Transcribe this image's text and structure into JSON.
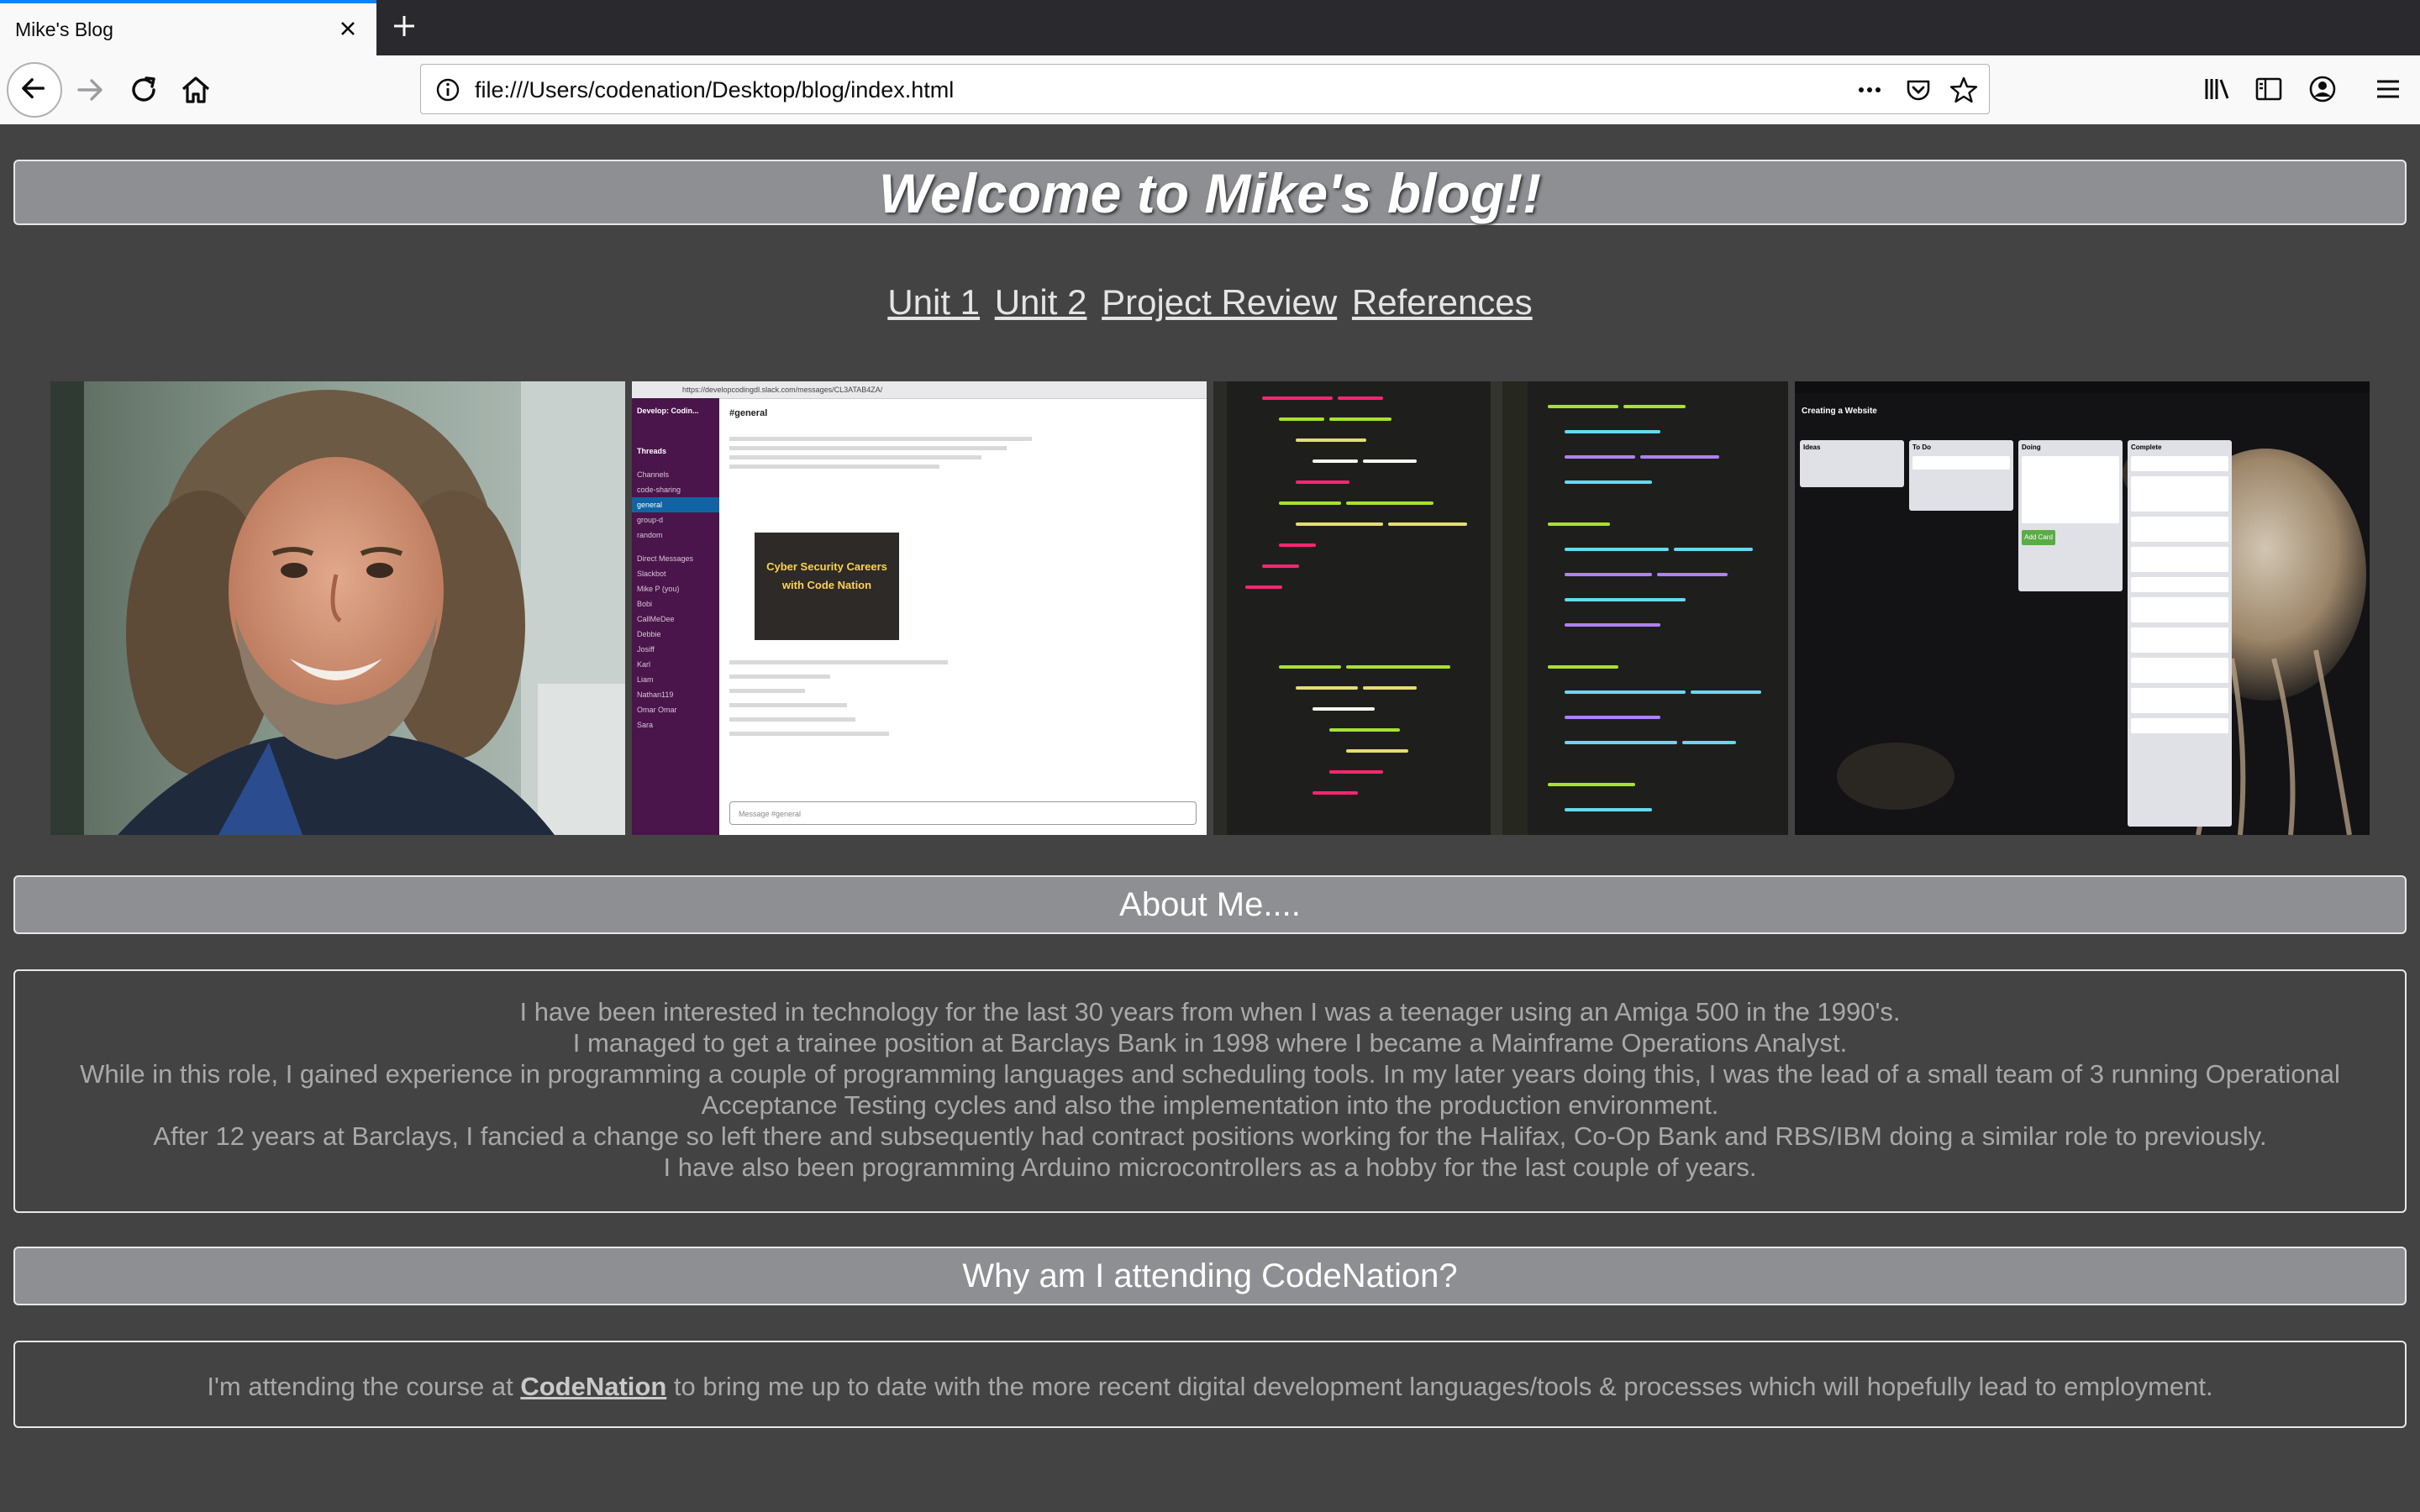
{
  "browser": {
    "tab_title": "Mike's Blog",
    "url": "file:///Users/codenation/Desktop/blog/index.html"
  },
  "page": {
    "title": "Welcome to Mike's blog!!",
    "nav": [
      "Unit 1",
      "Unit 2",
      "Project Review",
      "References"
    ],
    "about_heading": "About Me....",
    "about_lines": [
      "I have been interested in technology for the last 30 years from when I was a teenager using an Amiga 500 in the 1990's.",
      "I managed to get a trainee position at Barclays Bank in 1998 where I became a Mainframe Operations Analyst.",
      "While in this role, I gained experience in programming a couple of programming languages and scheduling tools. In my later years doing this, I was the lead of a small team of 3 running Operational Acceptance Testing cycles and also the implementation into the production environment.",
      "After 12 years at Barclays, I fancied a change so left there and subsequently had contract positions working for the Halifax, Co-Op Bank and RBS/IBM doing a similar role to previously.",
      "I have also been programming Arduino microcontrollers as a hobby for the last couple of years."
    ],
    "why_heading": "Why am I attending CodeNation?",
    "why_text_before": "I'm attending the course at ",
    "why_link": "CodeNation",
    "why_text_after": " to bring me up to date with the more recent digital development languages/tools & processes which will hopefully lead to employment."
  },
  "gallery": {
    "slack": {
      "url": "https://developcodingdl.slack.com/messages/CL3ATAB4ZA/",
      "workspace": "Develop: Codin...",
      "channel": "#general",
      "channels": [
        "code-sharing",
        "general",
        "group-d",
        "random"
      ],
      "dms": [
        "Slackbot",
        "Mike P (you)",
        "Bobi",
        "CallMeDee",
        "Debbie",
        "Josiff",
        "Karl",
        "Liam",
        "Nathan119",
        "Omar Omar",
        "Sara"
      ],
      "event_title": "Cyber Security Careers with Code Nation",
      "message_placeholder": "Message #general"
    },
    "trello": {
      "board_title": "Creating a Website",
      "lists": [
        "Ideas",
        "To Do",
        "Doing",
        "Complete"
      ],
      "add_card": "Add Card"
    }
  },
  "colors": {
    "page_bg": "#434343",
    "header_bg": "#8e8f93",
    "body_text": "#a9a9a9",
    "tab_accent": "#0a84ff"
  },
  "icons": [
    "close-icon",
    "plus-icon",
    "back-arrow-icon",
    "forward-arrow-icon",
    "reload-icon",
    "home-icon",
    "info-icon",
    "more-icon",
    "pocket-icon",
    "star-icon",
    "library-icon",
    "sidebar-icon",
    "account-icon",
    "menu-icon"
  ]
}
